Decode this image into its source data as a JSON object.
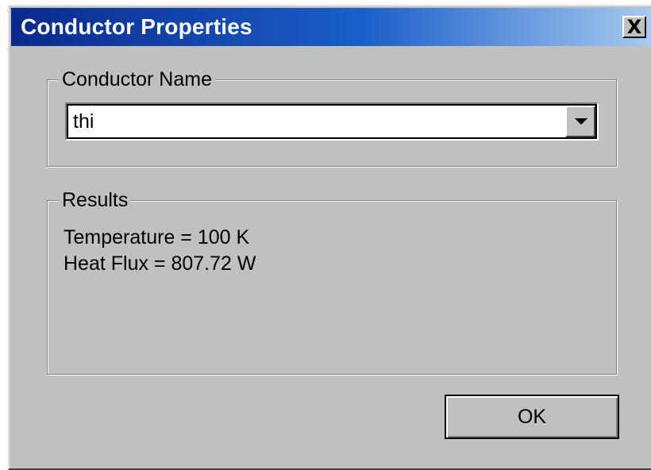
{
  "window": {
    "title": "Conductor Properties",
    "close_label": "X"
  },
  "conductor_group": {
    "label": "Conductor Name",
    "selected_value": "thi"
  },
  "results_group": {
    "label": "Results",
    "lines": [
      "Temperature = 100 K",
      "Heat Flux = 807.72 W"
    ]
  },
  "buttons": {
    "ok_label": "OK"
  },
  "colors": {
    "title_gradient_start": "#0a2a8c",
    "title_gradient_end": "#a6caf0",
    "dialog_bg": "#c0c0c0"
  }
}
